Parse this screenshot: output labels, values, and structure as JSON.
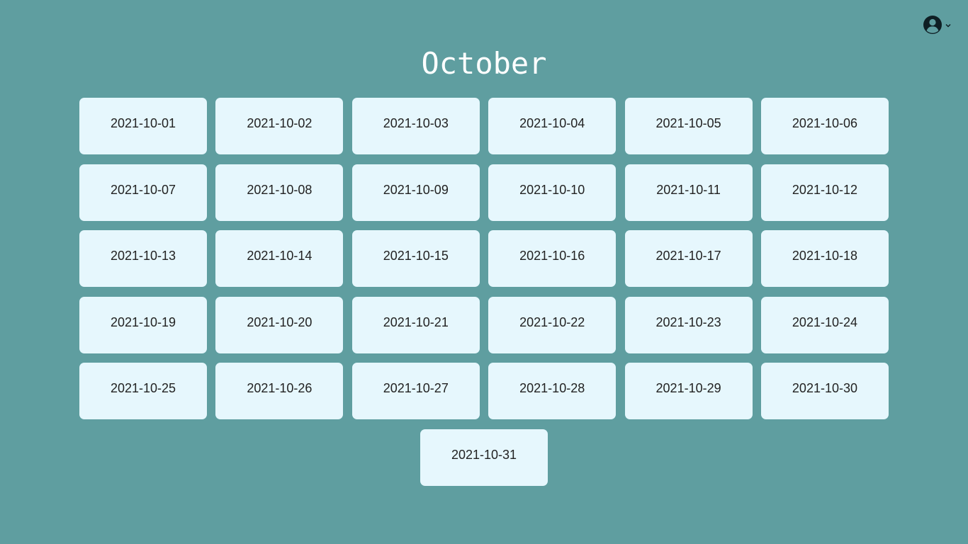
{
  "header": {
    "month_title": "October",
    "account_icon": "user-circle-icon",
    "dropdown_icon": "chevron-down-icon"
  },
  "colors": {
    "background": "#5f9ea0",
    "card": "#e6f7fd",
    "card_text": "#222222",
    "title": "#ffffff",
    "icon": "#0f1f24"
  },
  "days": [
    "2021-10-01",
    "2021-10-02",
    "2021-10-03",
    "2021-10-04",
    "2021-10-05",
    "2021-10-06",
    "2021-10-07",
    "2021-10-08",
    "2021-10-09",
    "2021-10-10",
    "2021-10-11",
    "2021-10-12",
    "2021-10-13",
    "2021-10-14",
    "2021-10-15",
    "2021-10-16",
    "2021-10-17",
    "2021-10-18",
    "2021-10-19",
    "2021-10-20",
    "2021-10-21",
    "2021-10-22",
    "2021-10-23",
    "2021-10-24",
    "2021-10-25",
    "2021-10-26",
    "2021-10-27",
    "2021-10-28",
    "2021-10-29",
    "2021-10-30",
    "2021-10-31"
  ]
}
